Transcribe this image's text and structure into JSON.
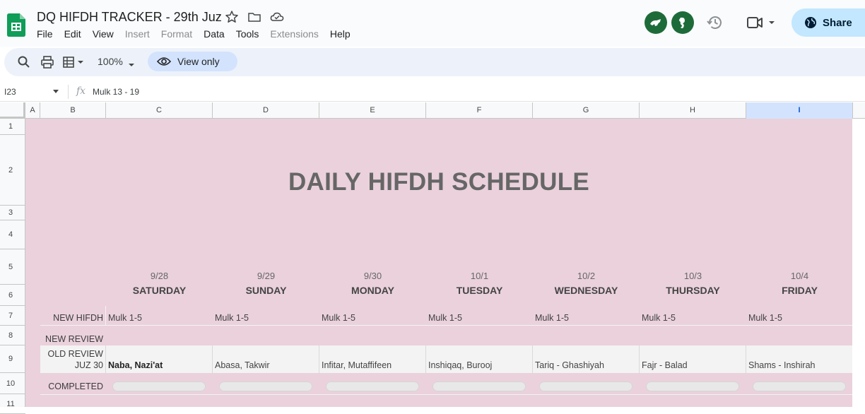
{
  "app": {
    "title": "DQ HIFDH TRACKER - 29th Juz",
    "menu": [
      "File",
      "Edit",
      "View",
      "Insert",
      "Format",
      "Data",
      "Tools",
      "Extensions",
      "Help"
    ],
    "menu_disabled": [
      "Insert",
      "Format",
      "Extensions"
    ],
    "share_label": "Share"
  },
  "toolbar": {
    "zoom": "100%",
    "view_only_label": "View only"
  },
  "formula_bar": {
    "cell_ref": "I23",
    "formula": "Mulk 13 - 19"
  },
  "columns": [
    "A",
    "B",
    "C",
    "D",
    "E",
    "F",
    "G",
    "H",
    "I"
  ],
  "selected_column": "I",
  "rows": [
    "1",
    "2",
    "3",
    "4",
    "5",
    "6",
    "7",
    "8",
    "9",
    "10",
    "11"
  ],
  "sheet": {
    "title": "DAILY HIFDH SCHEDULE",
    "days": [
      {
        "date": "9/28",
        "name": "SATURDAY"
      },
      {
        "date": "9/29",
        "name": "SUNDAY"
      },
      {
        "date": "9/30",
        "name": "MONDAY"
      },
      {
        "date": "10/1",
        "name": "TUESDAY"
      },
      {
        "date": "10/2",
        "name": "WEDNESDAY"
      },
      {
        "date": "10/3",
        "name": "THURSDAY"
      },
      {
        "date": "10/4",
        "name": "FRIDAY"
      }
    ],
    "labels": {
      "new_hifdh": "NEW HIFDH",
      "new_review": "NEW REVIEW",
      "old_review": "OLD REVIEW",
      "juz": "JUZ 30",
      "completed": "COMPLETED"
    },
    "new_hifdh": [
      "Mulk 1-5",
      "Mulk 1-5",
      "Mulk 1-5",
      "Mulk 1-5",
      "Mulk 1-5",
      "Mulk 1-5",
      "Mulk 1-5"
    ],
    "old_review": [
      "Naba, Nazi'at",
      "Abasa, Takwir",
      "Infitar, Mutaffifeen",
      "Inshiqaq, Burooj",
      "Tariq - Ghashiyah",
      "Fajr - Balad",
      "Shams - Inshirah"
    ]
  },
  "colors": {
    "sheet_bg": "#ead1dc",
    "share_bg": "#c2e7ff",
    "avatar_bg": "#1e6b3a"
  }
}
